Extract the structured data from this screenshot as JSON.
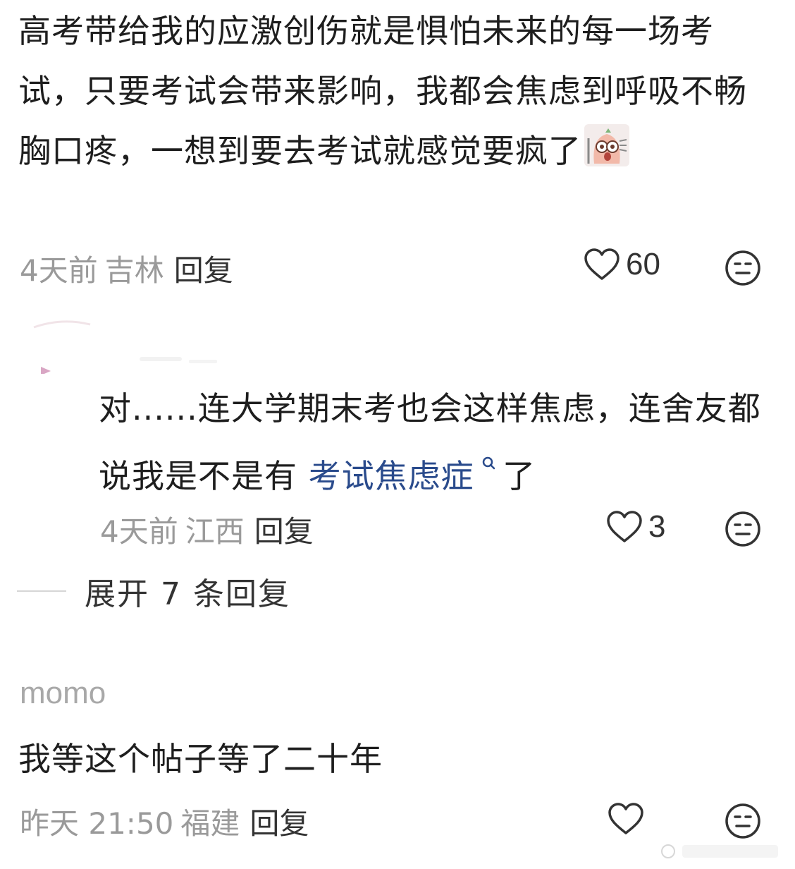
{
  "comments": [
    {
      "text": "高考带给我的应激创伤就是惧怕未来的每一场考试，只要考试会带来影响，我都会焦虑到呼吸不畅胸口疼，一想到要去考试就感觉要疯了",
      "sticker_icon": "shocked-sticker-icon",
      "time": "4天前",
      "location": "吉林",
      "reply_label": "回复",
      "like_count": "60",
      "replies": [
        {
          "text_before_link": "对......连大学期末考也会这样焦虑，连舍友都说我是不是有 ",
          "link_text": "考试焦虑症",
          "link_suffix_icon": "search-icon",
          "text_after_link": " 了",
          "time": "4天前",
          "location": "江西",
          "reply_label": "回复",
          "like_count": "3"
        }
      ],
      "expand_label": "展开 7 条回复"
    },
    {
      "username": "momo",
      "text": "我等这个帖子等了二十年",
      "time": "昨天 21:50",
      "location": "福建",
      "reply_label": "回复",
      "like_count": ""
    }
  ],
  "colors": {
    "text": "#1e1e1e",
    "meta": "#9a9a9a",
    "link": "#2a4b8c",
    "icon": "#333333"
  }
}
